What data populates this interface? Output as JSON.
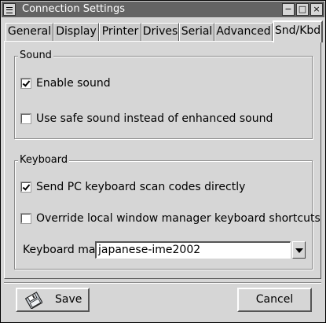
{
  "window": {
    "title": "Connection Settings"
  },
  "titlebar_buttons": {
    "minimize": "−",
    "maximize": "□",
    "close": "×"
  },
  "tabs": [
    {
      "label": "General",
      "active": false
    },
    {
      "label": "Display",
      "active": false
    },
    {
      "label": "Printer",
      "active": false
    },
    {
      "label": "Drives",
      "active": false
    },
    {
      "label": "Serial",
      "active": false
    },
    {
      "label": "Advanced",
      "active": false
    },
    {
      "label": "Snd/Kbd",
      "active": true
    }
  ],
  "sound": {
    "group_label": "Sound",
    "enable_sound": {
      "label": "Enable sound",
      "checked": true
    },
    "safe_sound": {
      "label": "Use safe sound instead of enhanced sound",
      "checked": false
    }
  },
  "keyboard": {
    "group_label": "Keyboard",
    "scan_codes": {
      "label": "Send PC keyboard scan codes directly",
      "checked": true
    },
    "override_shortcuts": {
      "label": "Override local window manager keyboard shortcuts",
      "checked": false
    },
    "map_label": "Keyboard map",
    "map_value": "japanese-ime2002"
  },
  "buttons": {
    "save": "Save",
    "cancel": "Cancel"
  },
  "icons": {
    "save_icon": "floppy-disk-icon",
    "dropdown_icon": "chevron-down-icon",
    "window_menu_icon": "window-menu-icon"
  }
}
